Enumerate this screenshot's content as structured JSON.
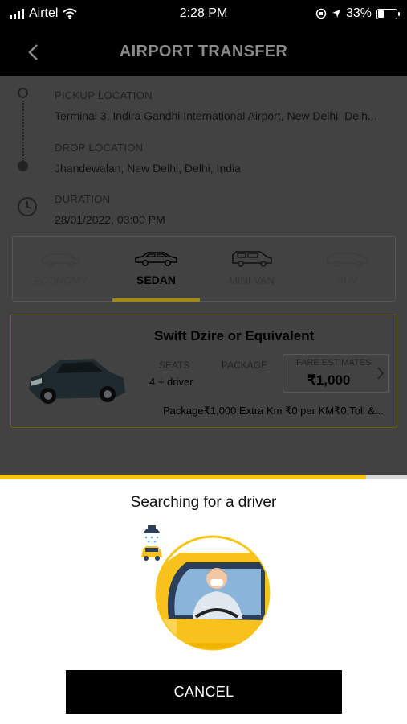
{
  "status_bar": {
    "carrier": "Airtel",
    "time": "2:28 PM",
    "battery": "33%",
    "battery_level": 0.33
  },
  "header": {
    "title": "AIRPORT TRANSFER",
    "back_icon": "chevron-left-icon"
  },
  "trip": {
    "pickup_label": "PICKUP LOCATION",
    "pickup_value": "Terminal 3, Indira Gandhi International Airport, New Delhi, Delh...",
    "drop_label": "DROP LOCATION",
    "drop_value": "Jhandewalan, New Delhi, Delhi, India",
    "duration_label": "DURATION",
    "duration_value": "28/01/2022, 03:00 PM"
  },
  "car_tabs": [
    {
      "label": "ECONOMY",
      "icon": "hatchback-icon"
    },
    {
      "label": "SEDAN",
      "icon": "sedan-icon",
      "active": true
    },
    {
      "label": "MINI VAN",
      "icon": "minivan-icon"
    },
    {
      "label": "SUV",
      "icon": "suv-icon"
    }
  ],
  "car_card": {
    "title": "Swift Dzire or Equivalent",
    "seats_label": "SEATS",
    "seats_value": "4 + driver",
    "package_label": "PACKAGE",
    "fare_label": "FARE ESTIMATES",
    "fare_value": "₹1,000",
    "package_text": "Package₹1,000,Extra Km ₹0 per KM₹0,Toll &..."
  },
  "search_progress": 0.9,
  "sheet": {
    "title": "Searching for a driver",
    "cancel_label": "CANCEL"
  },
  "colors": {
    "accent": "#f5c518",
    "header_bg": "#000000",
    "overlay": "#424242"
  }
}
